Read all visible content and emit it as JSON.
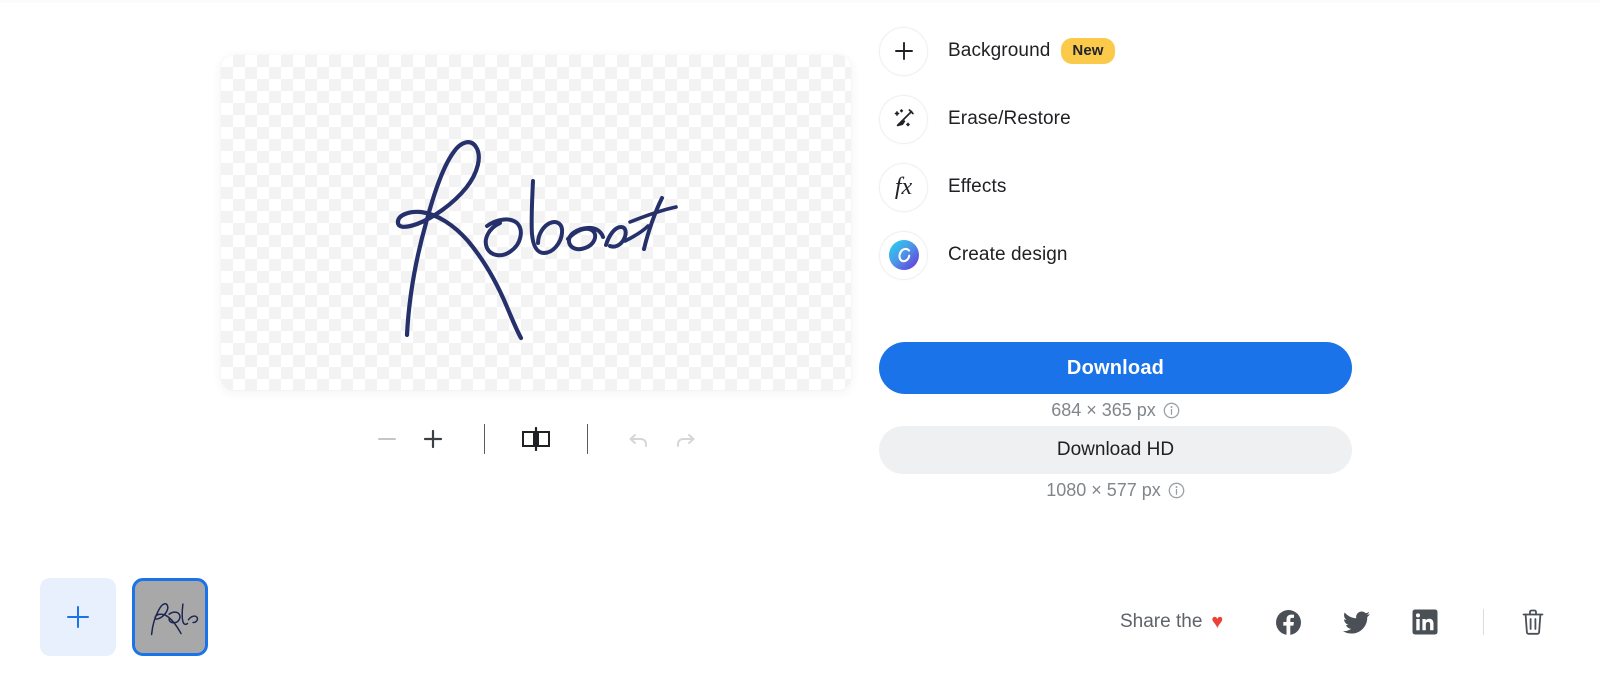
{
  "canvas": {
    "image_name": "Robert signature",
    "background": "transparent-checkerboard",
    "ink_color": "#26316b"
  },
  "canvas_toolbar": {
    "zoom_out": {
      "label": "−",
      "name": "zoom-out-button",
      "disabled": true
    },
    "zoom_in": {
      "label": "+",
      "name": "zoom-in-button",
      "disabled": false
    },
    "compare": {
      "label": "Compare",
      "name": "compare-before-after-button",
      "disabled": false
    },
    "undo": {
      "label": "Undo",
      "name": "undo-button",
      "disabled": true
    },
    "redo": {
      "label": "Redo",
      "name": "redo-button",
      "disabled": true
    }
  },
  "thumbnails": {
    "add_label": "+",
    "items": [
      {
        "name": "add-image-tile",
        "type": "add"
      },
      {
        "name": "image-thumbnail-robert",
        "type": "image",
        "selected": true,
        "alt": "Robert signature"
      }
    ]
  },
  "tools": [
    {
      "label": "Background",
      "icon": "plus-icon",
      "badge": "New"
    },
    {
      "label": "Erase/Restore",
      "icon": "magic-brush-icon",
      "badge": ""
    },
    {
      "label": "Effects",
      "icon": "fx-icon",
      "badge": ""
    },
    {
      "label": "Create design",
      "icon": "canva-logo-icon",
      "badge": ""
    }
  ],
  "download": {
    "primary_label": "Download",
    "primary_dimensions": "684 × 365 px",
    "hd_label": "Download HD",
    "hd_dimensions": "1080 × 577 px",
    "info_icon": "info-circle-icon"
  },
  "share": {
    "text": "Share the",
    "heart": "♥",
    "networks": [
      {
        "name": "facebook-share-button",
        "label": "Facebook"
      },
      {
        "name": "twitter-share-button",
        "label": "Twitter"
      },
      {
        "name": "linkedin-share-button",
        "label": "LinkedIn"
      }
    ],
    "delete_label": "Delete"
  },
  "colors": {
    "accent_blue": "#1a73e8",
    "badge_yellow": "#fbca4b",
    "heart_red": "#ea4335",
    "muted_text": "#80868b",
    "icon_gray": "#4a5056"
  }
}
